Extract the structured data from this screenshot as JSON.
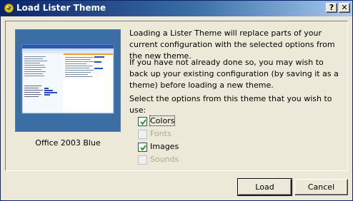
{
  "window": {
    "title": "Load Lister Theme",
    "help_button": "?",
    "close_button": "✕"
  },
  "preview": {
    "theme_name": "Office 2003 Blue"
  },
  "description": {
    "para1": "Loading a Lister Theme will replace parts of your current configuration with the selected options from the new theme.",
    "para2": "If you have not already done so, you may wish to back up your existing configuration (by saving it as a theme) before loading a new theme.",
    "para3": "Select the options from this theme that you wish to use:"
  },
  "options": [
    {
      "label": "Colors",
      "checked": true,
      "enabled": true
    },
    {
      "label": "Fonts",
      "checked": false,
      "enabled": false
    },
    {
      "label": "Images",
      "checked": true,
      "enabled": true
    },
    {
      "label": "Sounds",
      "checked": false,
      "enabled": false
    }
  ],
  "buttons": {
    "load": "Load",
    "cancel": "Cancel"
  },
  "colors": {
    "titlebar_start": "#0a246a",
    "titlebar_end": "#a6caf0",
    "dialog_bg": "#ece9d8",
    "preview_bg": "#3a6ea5"
  }
}
